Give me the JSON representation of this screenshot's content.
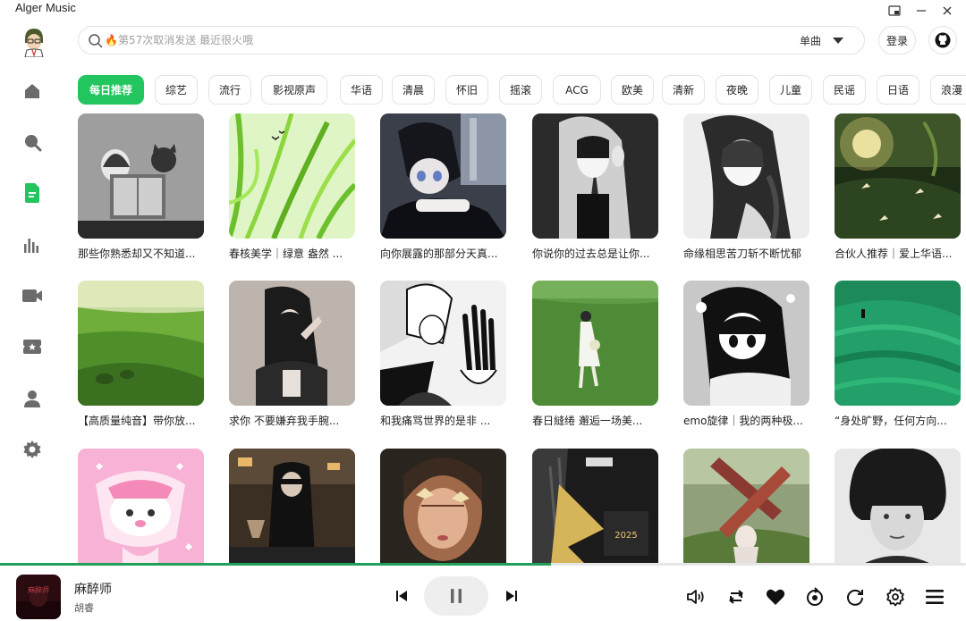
{
  "window": {
    "title": "Alger Music"
  },
  "search": {
    "placeholder": "第57次取消发送 最近很火哦",
    "type_label": "单曲"
  },
  "header": {
    "login_label": "登录"
  },
  "colors": {
    "accent": "#22c55e",
    "progress": "#22a05a"
  },
  "sidebar": {
    "items": [
      {
        "name": "home",
        "icon": "home-icon"
      },
      {
        "name": "search",
        "icon": "search-icon"
      },
      {
        "name": "playlist",
        "icon": "document-icon",
        "active": true
      },
      {
        "name": "charts",
        "icon": "bar-chart-icon"
      },
      {
        "name": "mv",
        "icon": "video-camera-icon"
      },
      {
        "name": "radio",
        "icon": "ticket-icon"
      },
      {
        "name": "user",
        "icon": "user-icon"
      },
      {
        "name": "settings",
        "icon": "gear-icon"
      }
    ]
  },
  "categories": [
    "每日推荐",
    "综艺",
    "流行",
    "影视原声",
    "华语",
    "清晨",
    "怀旧",
    "摇滚",
    "ACG",
    "欧美",
    "清新",
    "夜晚",
    "儿童",
    "民谣",
    "日语",
    "浪漫"
  ],
  "active_category": "每日推荐",
  "playlists": [
    {
      "title": "那些你熟悉却又不知道..."
    },
    {
      "title": "春核美学｜绿意 盎然 ..."
    },
    {
      "title": "向你展露的那部分天真..."
    },
    {
      "title": "你说你的过去总是让你..."
    },
    {
      "title": "命缘相思苦刀斩不断忧郁"
    },
    {
      "title": "合伙人推荐｜爱上华语..."
    },
    {
      "title": "【高质量纯音】带你放..."
    },
    {
      "title": "求你 不要嫌弃我手腕..."
    },
    {
      "title": "和我痛骂世界的是非 ..."
    },
    {
      "title": "春日縫绻 邂逅一场美..."
    },
    {
      "title": "emo旋律｜我的两种极..."
    },
    {
      "title": "“身处旷野，任何方向..."
    },
    {
      "title": ""
    },
    {
      "title": ""
    },
    {
      "title": ""
    },
    {
      "title": ""
    },
    {
      "title": ""
    },
    {
      "title": ""
    }
  ],
  "player": {
    "song_title": "麻醉师",
    "artist": "胡睿",
    "progress": 0.57
  }
}
